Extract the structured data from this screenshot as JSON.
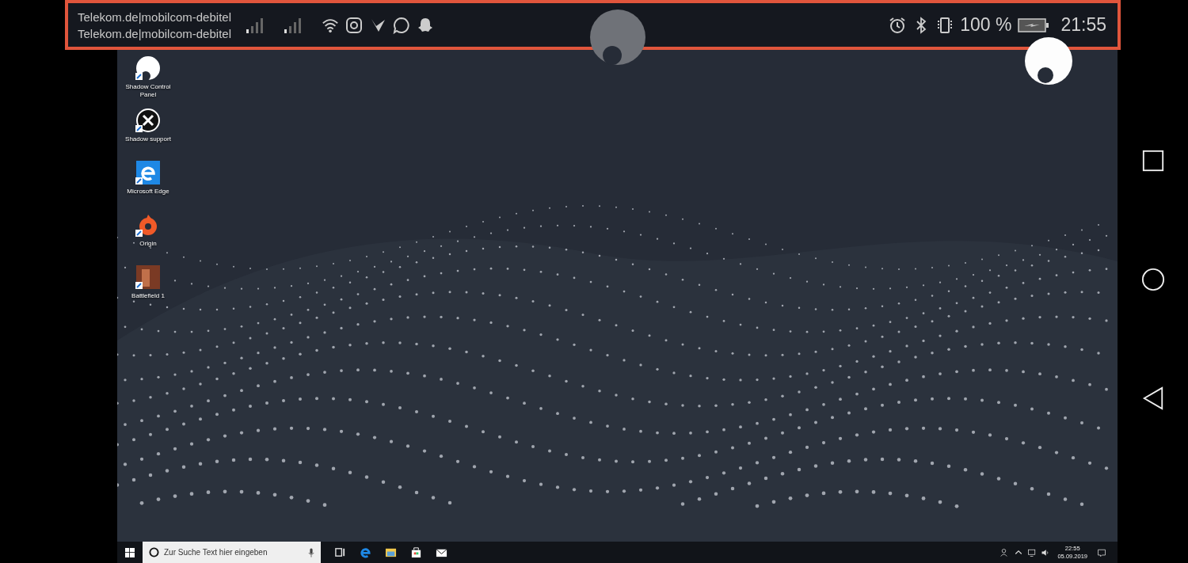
{
  "status_bar": {
    "carriers": [
      "Telekom.de|mobilcom-debitel",
      "Telekom.de|mobilcom-debitel"
    ],
    "battery": "100 %",
    "time": "21:55"
  },
  "desktop_icons": [
    {
      "label": "Shadow Control Panel",
      "kind": "shadow"
    },
    {
      "label": "Shadow support",
      "kind": "support"
    },
    {
      "label": "Microsoft Edge",
      "kind": "edge"
    },
    {
      "label": "Origin",
      "kind": "origin"
    },
    {
      "label": "Battlefield 1",
      "kind": "game"
    }
  ],
  "taskbar": {
    "search": {
      "placeholder": "Zur Suche Text hier eingeben"
    },
    "apps": [
      {
        "kind": "taskview"
      },
      {
        "kind": "edge"
      },
      {
        "kind": "explorer"
      },
      {
        "kind": "store"
      },
      {
        "kind": "mail"
      }
    ],
    "clock_time": "22:55",
    "clock_date": "05.09.2019"
  }
}
